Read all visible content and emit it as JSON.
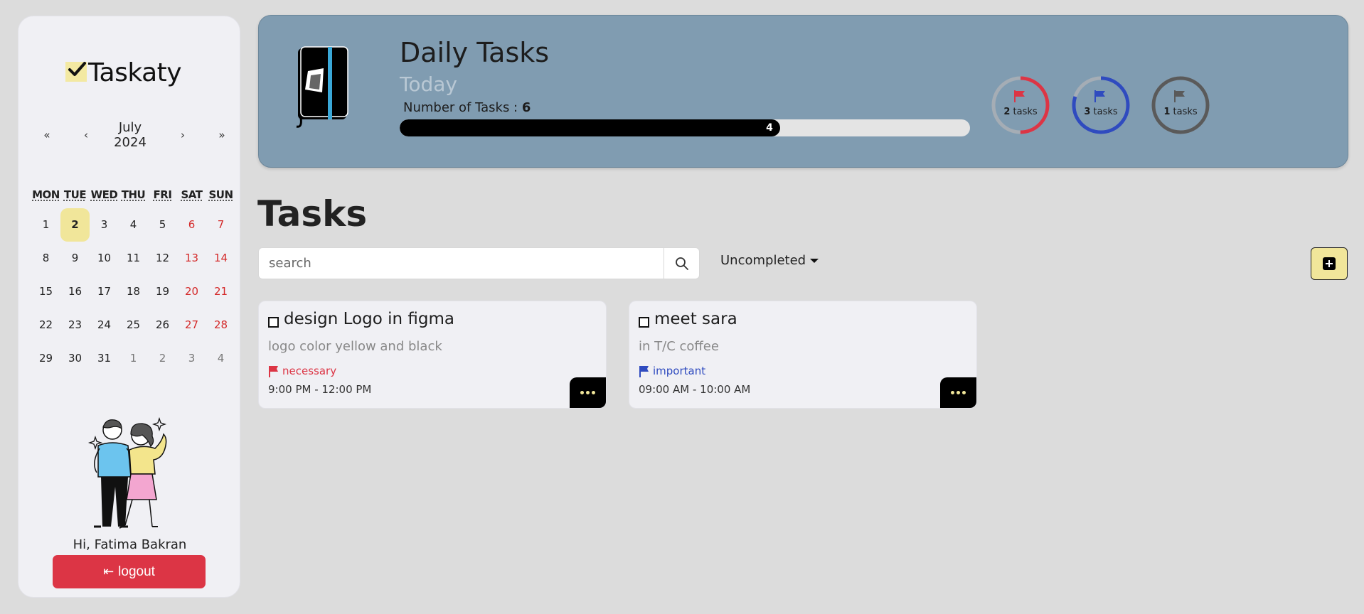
{
  "colors": {
    "accent": "#f1e69a",
    "banner": "#809cb1",
    "danger": "#dc3545",
    "necessary": "#dc3545",
    "important": "#2f4bbf",
    "normal": "#5a5a5a"
  },
  "sidebar": {
    "logo_text": "Taskaty",
    "calendar": {
      "nav_first": "«",
      "nav_prev": "‹",
      "nav_next": "›",
      "nav_last": "»",
      "month": "July",
      "year": "2024",
      "weekdays": [
        "MON",
        "TUE",
        "WED",
        "THU",
        "FRI",
        "SAT",
        "SUN"
      ],
      "weeks": [
        [
          "1",
          "2",
          "3",
          "4",
          "5",
          "6",
          "7"
        ],
        [
          "8",
          "9",
          "10",
          "11",
          "12",
          "13",
          "14"
        ],
        [
          "15",
          "16",
          "17",
          "18",
          "19",
          "20",
          "21"
        ],
        [
          "22",
          "23",
          "24",
          "25",
          "26",
          "27",
          "28"
        ],
        [
          "29",
          "30",
          "31",
          "1",
          "2",
          "3",
          "4"
        ]
      ],
      "selected_day": "2"
    },
    "greeting": "Hi, Fatima Bakran",
    "logout_label": "logout",
    "logout_icon": "logout-arrow-icon"
  },
  "banner": {
    "title": "Daily Tasks",
    "subtitle": "Today",
    "count_label": "Number of Tasks : ",
    "count_value": "6",
    "progress_value": "4",
    "progress_fraction": 0.667,
    "priority_rings": [
      {
        "count": "2",
        "unit": "tasks",
        "color": "#dc3545",
        "fraction": 0.5,
        "icon": "flag-icon"
      },
      {
        "count": "3",
        "unit": "tasks",
        "color": "#2f4bbf",
        "fraction": 0.8,
        "icon": "flag-icon"
      },
      {
        "count": "1",
        "unit": "tasks",
        "color": "#5a5a5a",
        "fraction": 1.0,
        "icon": "flag-icon"
      }
    ]
  },
  "tasks": {
    "heading": "Tasks",
    "search_placeholder": "search",
    "filter_label": "Uncompleted",
    "items": [
      {
        "title": "design Logo in figma",
        "description": "logo color yellow and black",
        "tag": "necessary",
        "tag_color": "#dc3545",
        "time": "9:00 PM - 12:00 PM"
      },
      {
        "title": "meet sara",
        "description": "in T/C coffee",
        "tag": "important",
        "tag_color": "#2f4bbf",
        "time": "09:00 AM - 10:00 AM"
      }
    ]
  }
}
